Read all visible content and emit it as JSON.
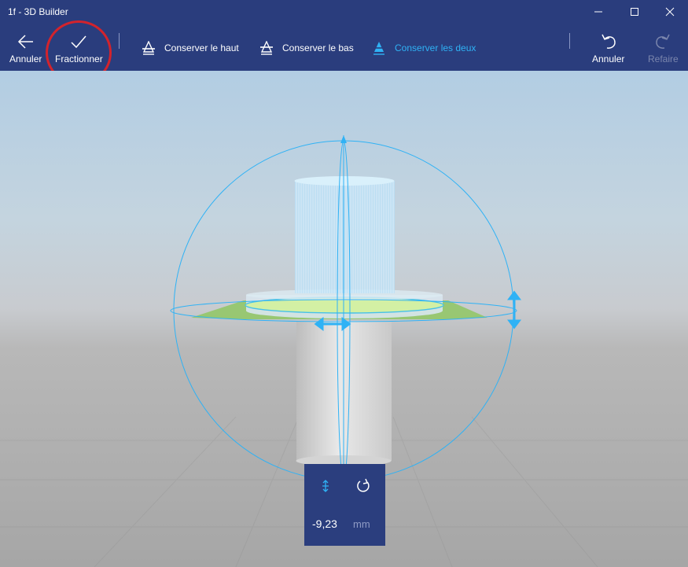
{
  "window": {
    "title": "1f - 3D Builder"
  },
  "toolbar": {
    "back_label": "Annuler",
    "split_label": "Fractionner",
    "options": [
      {
        "label": "Conserver le haut",
        "active": false
      },
      {
        "label": "Conserver le bas",
        "active": false
      },
      {
        "label": "Conserver les deux",
        "active": true
      }
    ],
    "undo_label": "Annuler",
    "redo_label": "Refaire"
  },
  "panel": {
    "value": "-9,23",
    "unit": "mm"
  },
  "colors": {
    "accent": "#2fb2f5",
    "chrome": "#2a3d7d",
    "highlight_circle": "#d3232c",
    "plane": "#8fc763"
  }
}
